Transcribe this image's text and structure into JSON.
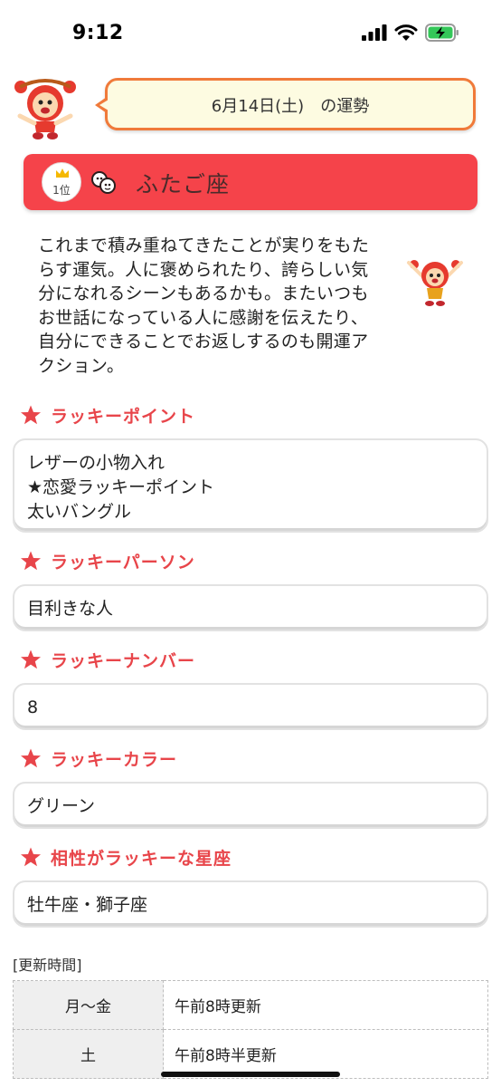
{
  "status_bar": {
    "time": "9:12"
  },
  "header": {
    "date_text": "6月14日(土)　の運勢"
  },
  "sign": {
    "rank": "1位",
    "name": "ふたご座"
  },
  "fortune": {
    "text": "これまで積み重ねてきたことが実りをもたらす運気。人に褒められたり、誇らしい気分になれるシーンもあるかも。またいつもお世話になっている人に感謝を伝えたり、自分にできることでお返しするのも開運アクション。"
  },
  "sections": [
    {
      "title": "ラッキーポイント",
      "lines": [
        "レザーの小物入れ",
        "★恋愛ラッキーポイント",
        "太いバングル"
      ]
    },
    {
      "title": "ラッキーパーソン",
      "lines": [
        "目利きな人"
      ]
    },
    {
      "title": "ラッキーナンバー",
      "lines": [
        "8"
      ]
    },
    {
      "title": "ラッキーカラー",
      "lines": [
        "グリーン"
      ]
    },
    {
      "title": "相性がラッキーな星座",
      "lines": [
        "牡牛座・獅子座"
      ]
    }
  ],
  "update": {
    "label": "[更新時間]",
    "rows": [
      {
        "day": "月～金",
        "time": "午前8時更新"
      },
      {
        "day": "土",
        "time": "午前8時半更新"
      }
    ]
  },
  "colors": {
    "banner": "#f5434a",
    "accent": "#e8454a",
    "bubble_border": "#f07a3a",
    "bubble_bg": "#fdfbe1"
  }
}
